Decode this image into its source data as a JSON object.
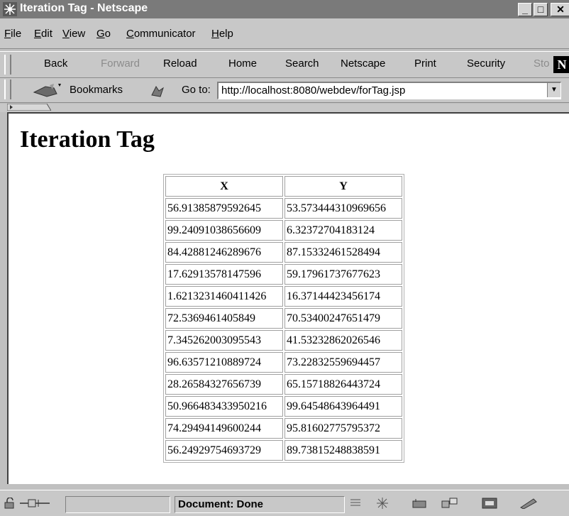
{
  "window": {
    "title": "Iteration Tag - Netscape",
    "min_glyph": "_",
    "max_glyph": "□",
    "close_glyph": "✕"
  },
  "menu": [
    {
      "id": "file",
      "label": "File",
      "underline": "F",
      "rest": "ile"
    },
    {
      "id": "edit",
      "label": "Edit",
      "underline": "E",
      "rest": "dit"
    },
    {
      "id": "view",
      "label": "View",
      "underline": "V",
      "rest": "iew"
    },
    {
      "id": "go",
      "label": "Go",
      "underline": "G",
      "rest": "o"
    },
    {
      "id": "communicator",
      "label": "Communicator",
      "underline": "C",
      "rest": "ommunicator"
    },
    {
      "id": "help",
      "label": "Help",
      "underline": "H",
      "rest": "elp"
    }
  ],
  "toolbar": {
    "back": "Back",
    "forward": "Forward",
    "reload": "Reload",
    "home": "Home",
    "search": "Search",
    "netscape": "Netscape",
    "print": "Print",
    "security": "Security",
    "stop": "Sto",
    "logo": "N"
  },
  "location": {
    "bookmarks_label": "Bookmarks",
    "goto_label": "Go to:",
    "url": "http://localhost:8080/webdev/forTag.jsp"
  },
  "page": {
    "heading": "Iteration Tag",
    "table": {
      "headers": [
        "X",
        "Y"
      ],
      "rows": [
        [
          "56.91385879592645",
          "53.573444310969656"
        ],
        [
          "99.24091038656609",
          "6.32372704183124"
        ],
        [
          "84.42881246289676",
          "87.15332461528494"
        ],
        [
          "17.62913578147596",
          "59.17961737677623"
        ],
        [
          "1.6213231460411426",
          "16.37144423456174"
        ],
        [
          "72.5369461405849",
          "70.53400247651479"
        ],
        [
          "7.345262003095543",
          "41.53232862026546"
        ],
        [
          "96.63571210889724",
          "73.22832559694457"
        ],
        [
          "28.26584327656739",
          "65.15718826443724"
        ],
        [
          "50.966483433950216",
          "99.64548643964491"
        ],
        [
          "74.29494149600244",
          "95.81602775795372"
        ],
        [
          "56.24929754693729",
          "89.73815248838591"
        ]
      ]
    }
  },
  "status": {
    "text": "Document: Done"
  },
  "colors": {
    "titlebar": "#7a7a7a",
    "chrome": "#c8c8c8",
    "content_bg": "#ffffff"
  }
}
